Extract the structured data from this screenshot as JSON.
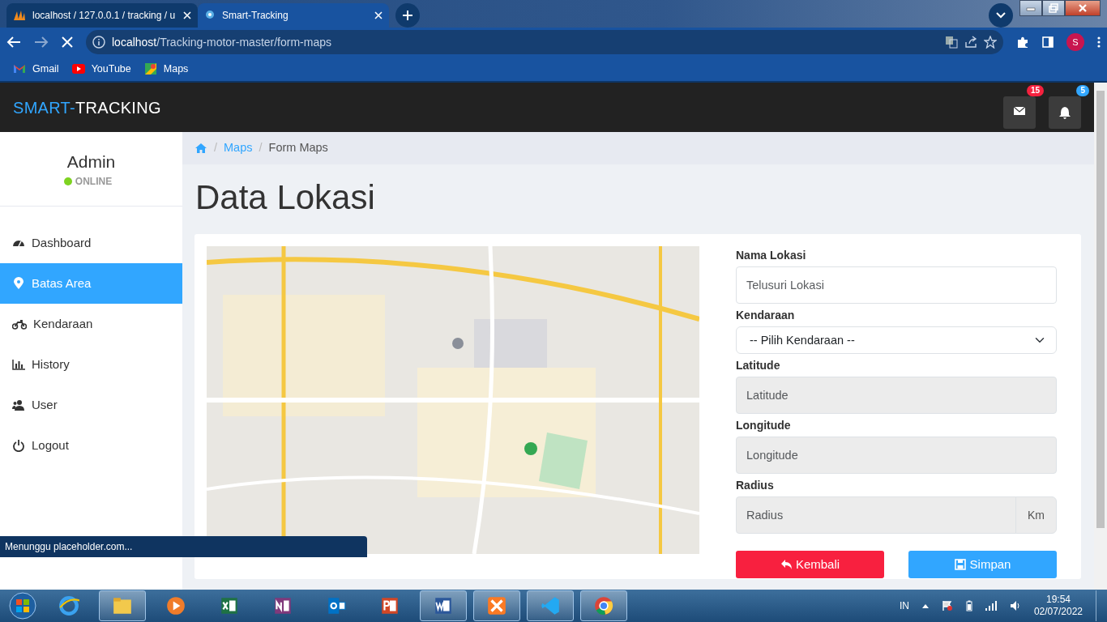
{
  "browser": {
    "tabs": [
      {
        "title": "localhost / 127.0.0.1 / tracking / u",
        "selected": false
      },
      {
        "title": "Smart-Tracking",
        "selected": true
      }
    ],
    "url_host": "localhost",
    "url_path": "/Tracking-motor-master/form-maps",
    "profile_initial": "S",
    "bookmarks": [
      {
        "label": "Gmail",
        "kind": "gmail"
      },
      {
        "label": "YouTube",
        "kind": "youtube"
      },
      {
        "label": "Maps",
        "kind": "maps"
      }
    ]
  },
  "app": {
    "brand_prefix": "SMART-",
    "brand_suffix": "TRACKING",
    "notifications": [
      {
        "kind": "mail",
        "count": "15",
        "color": "#f5213e"
      },
      {
        "kind": "bell",
        "count": "5",
        "color": "#31a6ff"
      }
    ]
  },
  "user": {
    "name": "Admin",
    "status": "ONLINE"
  },
  "sidebar": {
    "items": [
      {
        "label": "Dashboard",
        "kind": "dashboard",
        "selected": false
      },
      {
        "label": "Batas Area",
        "kind": "marker",
        "selected": true
      },
      {
        "label": "Kendaraan",
        "kind": "motorcycle",
        "selected": false
      },
      {
        "label": "History",
        "kind": "chart",
        "selected": false
      },
      {
        "label": "User",
        "kind": "users",
        "selected": false
      },
      {
        "label": "Logout",
        "kind": "power",
        "selected": false
      }
    ]
  },
  "breadcrumb": [
    {
      "separator": "/",
      "label": "Maps",
      "link": true
    },
    {
      "separator": "/",
      "label": "Form Maps",
      "link": false
    }
  ],
  "page_title": "Data Lokasi",
  "form": {
    "fields": [
      {
        "label": "Nama Lokasi",
        "kind": "text",
        "placeholder": "Telusuri Lokasi",
        "disabled": false
      },
      {
        "label": "Kendaraan",
        "kind": "select",
        "value": "-- Pilih Kendaraan --"
      },
      {
        "label": "Latitude",
        "kind": "text",
        "placeholder": "Latitude",
        "disabled": true
      },
      {
        "label": "Longitude",
        "kind": "text",
        "placeholder": "Longitude",
        "disabled": true
      },
      {
        "label": "Radius",
        "kind": "text",
        "placeholder": "Radius",
        "disabled": true,
        "suffix": "Km"
      }
    ],
    "buttons": [
      {
        "label": "Kembali",
        "kind": "back"
      },
      {
        "label": "Simpan",
        "kind": "save"
      }
    ]
  },
  "status_text": "Menunggu placeholder.com...",
  "taskbar": {
    "apps": [
      {
        "kind": "ie",
        "running": false
      },
      {
        "kind": "explorer",
        "running": true
      },
      {
        "kind": "media",
        "running": false
      },
      {
        "kind": "excel",
        "running": false
      },
      {
        "kind": "onenote",
        "running": false
      },
      {
        "kind": "outlook",
        "running": false
      },
      {
        "kind": "powerpoint",
        "running": false
      },
      {
        "kind": "word",
        "running": true
      },
      {
        "kind": "xampp",
        "running": true
      },
      {
        "kind": "vscode",
        "running": true
      },
      {
        "kind": "chrome",
        "running": true
      }
    ],
    "language": "IN",
    "time": "19:54",
    "date": "02/07/2022"
  }
}
